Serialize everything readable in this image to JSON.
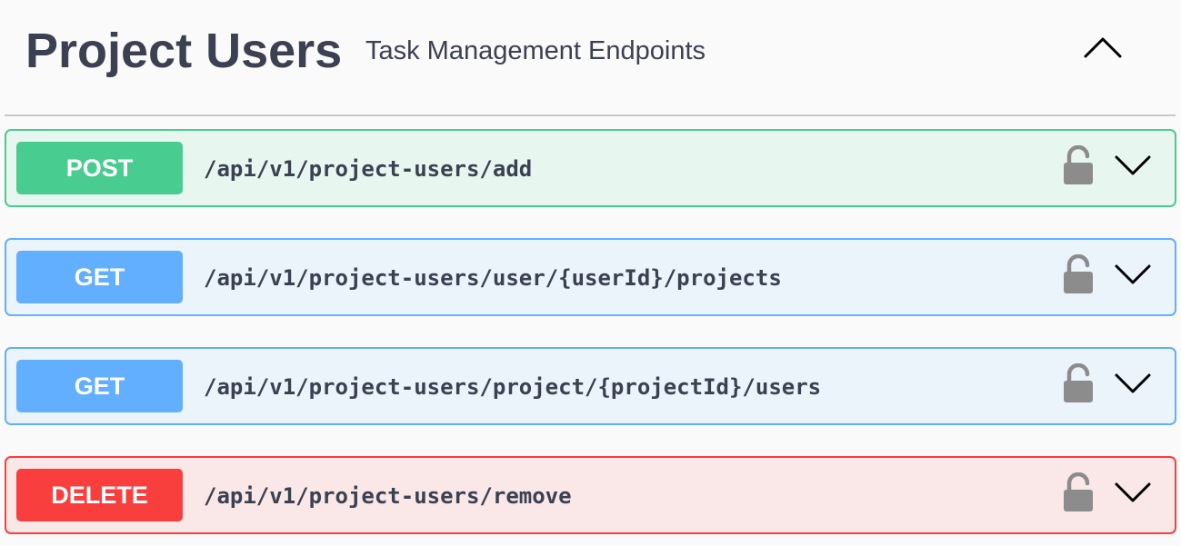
{
  "section": {
    "title": "Project Users",
    "description": "Task Management Endpoints"
  },
  "icons": {
    "collapse": "chevron-up-icon",
    "expand": "chevron-down-icon",
    "auth": "lock-icon"
  },
  "colors": {
    "post": "#49cc90",
    "get": "#61affe",
    "delete": "#f93e3e",
    "text": "#3b4151",
    "lock": "#8c8c8c"
  },
  "endpoints": [
    {
      "method": "POST",
      "path": "/api/v1/project-users/add"
    },
    {
      "method": "GET",
      "path": "/api/v1/project-users/user/{userId}/projects"
    },
    {
      "method": "GET",
      "path": "/api/v1/project-users/project/{projectId}/users"
    },
    {
      "method": "DELETE",
      "path": "/api/v1/project-users/remove"
    }
  ]
}
